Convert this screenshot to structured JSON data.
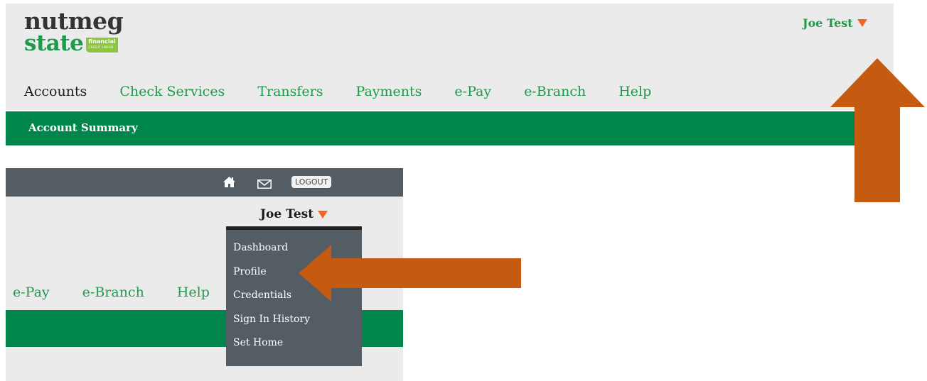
{
  "brand": {
    "line1": "nutmeg",
    "line2": "state",
    "tag_line1": "financial",
    "tag_line2": "CREDIT UNION"
  },
  "user": {
    "name": "Joe Test"
  },
  "nav": [
    {
      "label": "Accounts",
      "active": true
    },
    {
      "label": "Check Services",
      "active": false
    },
    {
      "label": "Transfers",
      "active": false
    },
    {
      "label": "Payments",
      "active": false
    },
    {
      "label": "e-Pay",
      "active": false
    },
    {
      "label": "e-Branch",
      "active": false
    },
    {
      "label": "Help",
      "active": false
    }
  ],
  "subnav": {
    "label": "Account Summary"
  },
  "crop": {
    "toolbar": {
      "logout_label": "LOGOUT"
    },
    "user_name": "Joe Test",
    "nav": [
      "e-Pay",
      "e-Branch",
      "Help"
    ],
    "menu": [
      "Dashboard",
      "Profile",
      "Credentials",
      "Sign In History",
      "Set Home"
    ]
  },
  "colors": {
    "brand_green": "#1f9a4b",
    "bar_green": "#00864a",
    "accent_orange": "#f26522",
    "arrow": "#c55a11",
    "toolbar_gray": "#545d63"
  },
  "icons": [
    "home-icon",
    "mail-icon",
    "caret-down-icon",
    "arrow-up-annotation",
    "arrow-left-annotation"
  ]
}
